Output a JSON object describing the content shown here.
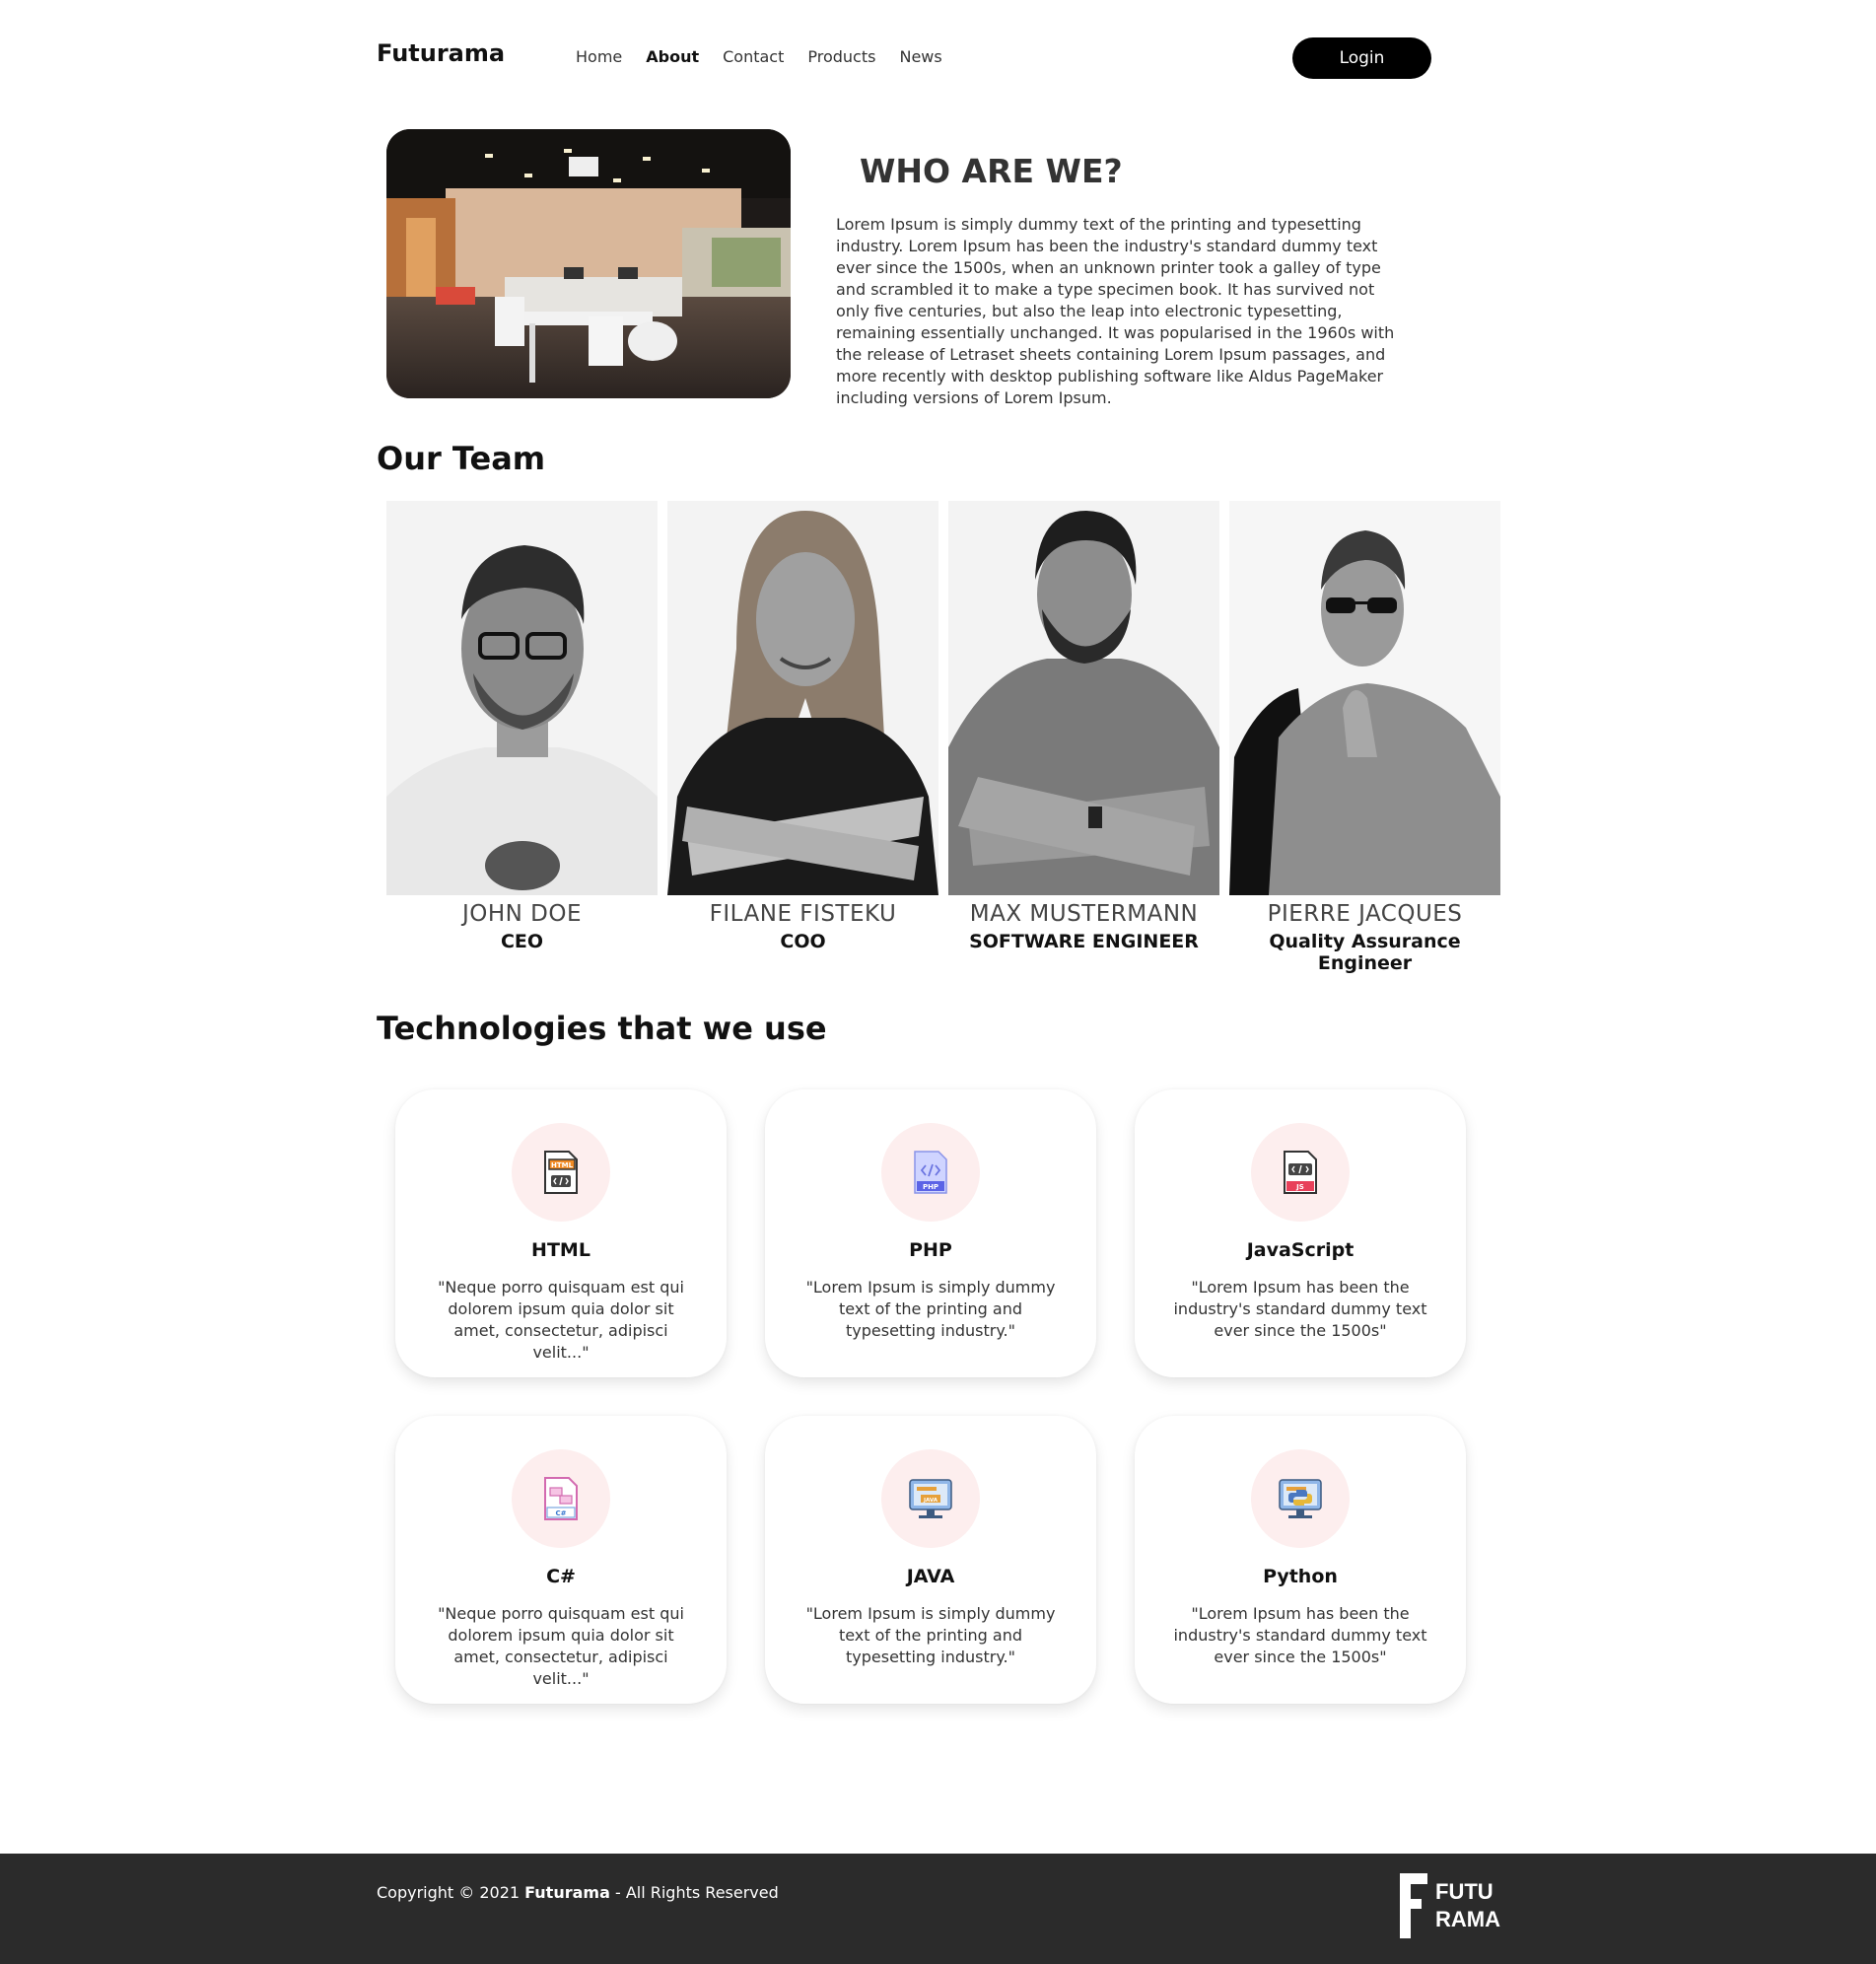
{
  "header": {
    "brand": "Futurama",
    "nav": [
      "Home",
      "About",
      "Contact",
      "Products",
      "News"
    ],
    "active_nav": "About",
    "login_label": "Login"
  },
  "about": {
    "title": "WHO ARE WE?",
    "text": "Lorem Ipsum is simply dummy text of the printing and typesetting industry. Lorem Ipsum has been the industry's standard dummy text ever since the 1500s, when an unknown printer took a galley of type and scrambled it to make a type specimen book. It has survived not only five centuries, but also the leap into electronic typesetting, remaining essentially unchanged. It was popularised in the 1960s with the release of Letraset sheets containing Lorem Ipsum passages, and more recently with desktop publishing software like Aldus PageMaker including versions of Lorem Ipsum."
  },
  "team": {
    "title": "Our Team",
    "members": [
      {
        "name": "JOHN DOE",
        "role": "CEO"
      },
      {
        "name": "FILANE FISTEKU",
        "role": "COO"
      },
      {
        "name": "MAX MUSTERMANN",
        "role": "SOFTWARE ENGINEER"
      },
      {
        "name": "PIERRE JACQUES",
        "role": "Quality Assurance Engineer"
      }
    ]
  },
  "technologies": {
    "title": "Technologies that we use",
    "items": [
      {
        "name": "HTML",
        "icon": "html-file-icon",
        "text": "\"Neque porro quisquam est qui dolorem ipsum quia dolor sit amet, consectetur, adipisci velit...\""
      },
      {
        "name": "PHP",
        "icon": "php-file-icon",
        "text": "\"Lorem Ipsum is simply dummy text of the printing and typesetting industry.\""
      },
      {
        "name": "JavaScript",
        "icon": "js-file-icon",
        "text": "\"Lorem Ipsum has been the industry's standard dummy text ever since the 1500s\""
      },
      {
        "name": "C#",
        "icon": "csharp-file-icon",
        "text": "\"Neque porro quisquam est qui dolorem ipsum quia dolor sit amet, consectetur, adipisci velit...\""
      },
      {
        "name": "JAVA",
        "icon": "java-monitor-icon",
        "text": "\"Lorem Ipsum is simply dummy text of the printing and typesetting industry.\""
      },
      {
        "name": "Python",
        "icon": "python-monitor-icon",
        "text": "\"Lorem Ipsum has been the industry's standard dummy text ever since the 1500s\""
      }
    ]
  },
  "footer": {
    "copyright_prefix": "Copyright © 2021 ",
    "copyright_brand": "Futurama",
    "copyright_suffix": " - All Rights Reserved",
    "logo_line1": "FUTU",
    "logo_line2": "RAMA"
  },
  "colors": {
    "accent": "#000000",
    "footer_bg": "#2b2b2b",
    "icon_circle": "#fdeeee"
  }
}
